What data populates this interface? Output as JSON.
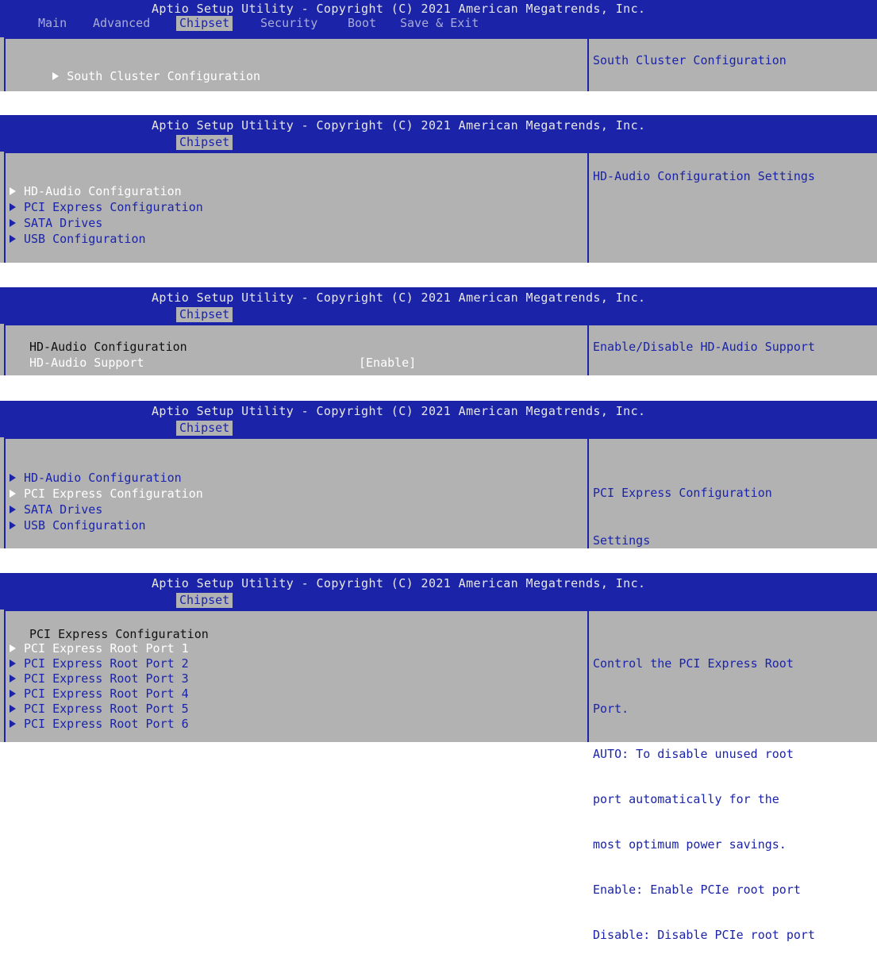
{
  "title": "Aptio Setup Utility - Copyright (C) 2021 American Megatrends, Inc.",
  "screen1": {
    "tabs": [
      "Main",
      "Advanced",
      "Chipset",
      "Security",
      "Boot",
      "Save & Exit"
    ],
    "selected_tab": "Chipset",
    "items": [
      "South Cluster Configuration"
    ],
    "help": "South Cluster Configuration"
  },
  "screen2": {
    "tab": "Chipset",
    "items": [
      "HD-Audio Configuration",
      "PCI Express Configuration",
      "SATA Drives",
      "USB Configuration"
    ],
    "help": "HD-Audio Configuration Settings"
  },
  "screen3": {
    "tab": "Chipset",
    "heading": "HD-Audio Configuration",
    "setting_label": "HD-Audio Support",
    "setting_value": "[Enable]",
    "help": "Enable/Disable HD-Audio Support"
  },
  "screen4": {
    "tab": "Chipset",
    "items": [
      "HD-Audio Configuration",
      "PCI Express Configuration",
      "SATA Drives",
      "USB Configuration"
    ],
    "help_lines": [
      "PCI Express Configuration",
      "Settings"
    ]
  },
  "screen5": {
    "tab": "Chipset",
    "heading": "PCI Express Configuration",
    "items": [
      "PCI Express Root Port 1",
      "PCI Express Root Port 2",
      "PCI Express Root Port 3",
      "PCI Express Root Port 4",
      "PCI Express Root Port 5",
      "PCI Express Root Port 6"
    ],
    "help_lines": [
      "Control the PCI Express Root",
      "Port.",
      "AUTO: To disable unused root",
      "port automatically for the",
      "most optimum power savings.",
      "Enable: Enable PCIe root port",
      "Disable: Disable PCIe root port"
    ]
  },
  "colors": {
    "header_blue": "#1b24a8",
    "body_gray": "#b2b2b2",
    "highlight_white": "#ffffff"
  }
}
